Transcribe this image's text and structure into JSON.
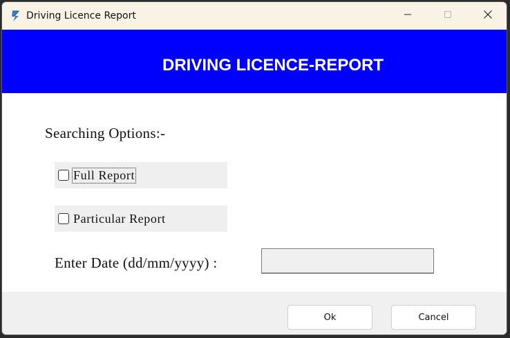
{
  "window": {
    "title": "Driving Licence Report",
    "icons": {
      "app": "app-icon",
      "minimize": "minimize-icon",
      "maximize": "maximize-icon",
      "close": "close-icon"
    }
  },
  "banner": {
    "title": "DRIVING LICENCE-REPORT",
    "color": "#0000ff"
  },
  "form": {
    "section_label": "Searching Options:-",
    "options": [
      {
        "label": "Full Report",
        "checked": false,
        "focused": true
      },
      {
        "label": "Particular Report",
        "checked": false,
        "focused": false
      }
    ],
    "date_label": "Enter Date (dd/mm/yyyy) :",
    "date_value": ""
  },
  "buttons": {
    "ok": "Ok",
    "cancel": "Cancel"
  }
}
